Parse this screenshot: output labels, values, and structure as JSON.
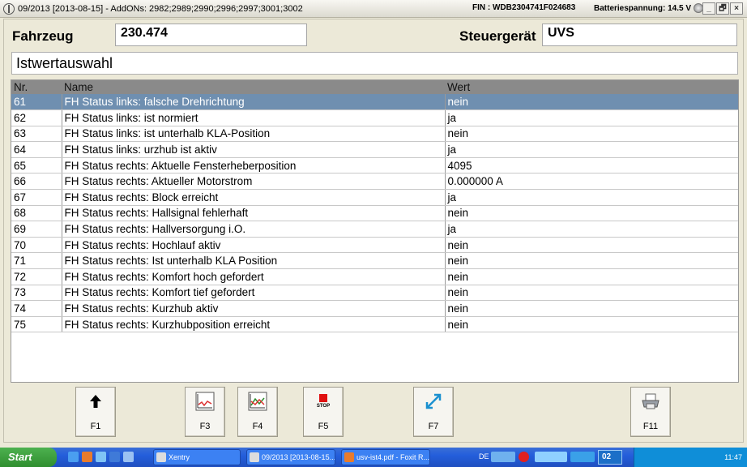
{
  "window": {
    "title": "09/2013 [2013-08-15] - AddONs: 2982;2989;2990;2996;2997;3001;3002",
    "fin": "FIN : WDB2304741F024683",
    "battery": "Batteriespannung: 14.5 V",
    "minimize": "_",
    "restore": "🗗",
    "close": "×"
  },
  "header": {
    "fahrzeug_label": "Fahrzeug",
    "fahrzeug_value": "230.474",
    "steuergeraet_label": "Steuergerät",
    "steuergeraet_value": "UVS",
    "section_title": "Istwertauswahl"
  },
  "table": {
    "columns": [
      "Nr.",
      "Name",
      "Wert"
    ],
    "rows": [
      {
        "nr": "61",
        "name": "FH Status links: falsche Drehrichtung",
        "wert": "nein"
      },
      {
        "nr": "62",
        "name": "FH Status links: ist normiert",
        "wert": "ja"
      },
      {
        "nr": "63",
        "name": "FH Status links: ist unterhalb KLA-Position",
        "wert": "nein"
      },
      {
        "nr": "64",
        "name": "FH Status links: urzhub ist aktiv",
        "wert": "ja"
      },
      {
        "nr": "65",
        "name": "FH Status rechts: Aktuelle Fensterheberposition",
        "wert": "4095"
      },
      {
        "nr": "66",
        "name": "FH Status rechts: Aktueller Motorstrom",
        "wert": "0.000000 A"
      },
      {
        "nr": "67",
        "name": "FH Status rechts: Block erreicht",
        "wert": "ja"
      },
      {
        "nr": "68",
        "name": "FH Status rechts: Hallsignal fehlerhaft",
        "wert": "nein"
      },
      {
        "nr": "69",
        "name": "FH Status rechts: Hallversorgung i.O.",
        "wert": "ja"
      },
      {
        "nr": "70",
        "name": "FH Status rechts: Hochlauf aktiv",
        "wert": "nein"
      },
      {
        "nr": "71",
        "name": "FH Status rechts: Ist unterhalb KLA Position",
        "wert": "nein"
      },
      {
        "nr": "72",
        "name": "FH Status rechts: Komfort hoch gefordert",
        "wert": "nein"
      },
      {
        "nr": "73",
        "name": "FH Status rechts: Komfort tief gefordert",
        "wert": "nein"
      },
      {
        "nr": "74",
        "name": "FH Status rechts: Kurzhub aktiv",
        "wert": "nein"
      },
      {
        "nr": "75",
        "name": "FH Status rechts: Kurzhubposition erreicht",
        "wert": "nein"
      }
    ],
    "selected_nr": "61"
  },
  "buttons": [
    {
      "key": "F1",
      "icon": "arrow-up-icon"
    },
    {
      "key": "F3",
      "icon": "chart-icon"
    },
    {
      "key": "F4",
      "icon": "chart-multi-icon"
    },
    {
      "key": "F5",
      "icon": "stop-icon",
      "icon_text": "STOP"
    },
    {
      "key": "F7",
      "icon": "swap-arrows-icon"
    },
    {
      "key": "F11",
      "icon": "printer-icon"
    }
  ],
  "taskbar": {
    "start": "Start",
    "tasks": [
      "Xentry",
      "09/2013 [2013-08-15...",
      "usv-ist4.pdf - Foxit R..."
    ],
    "lang": "DE",
    "badge": "02",
    "clock": "11:47"
  },
  "colors": {
    "selected_row": "#6f8fb0",
    "header_row": "#8a8a8a",
    "stop_red": "#e01010",
    "taskbar_blue": "#245edb"
  }
}
